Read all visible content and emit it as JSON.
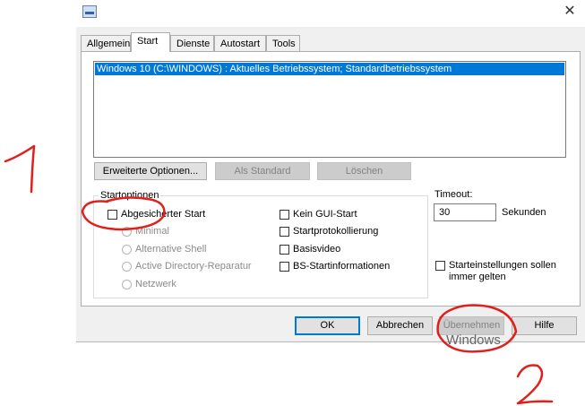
{
  "window": {
    "close_glyph": "✕"
  },
  "tabs": [
    {
      "label": "Allgemein",
      "active": false
    },
    {
      "label": "Start",
      "active": true
    },
    {
      "label": "Dienste",
      "active": false
    },
    {
      "label": "Autostart",
      "active": false
    },
    {
      "label": "Tools",
      "active": false
    }
  ],
  "boot_list": {
    "entries": [
      "Windows 10 (C:\\WINDOWS) : Aktuelles Betriebssystem; Standardbetriebssystem"
    ]
  },
  "boot_buttons": {
    "advanced": "Erweiterte Optionen...",
    "set_default": "Als Standard",
    "delete": "Löschen"
  },
  "start_options": {
    "title": "Startoptionen",
    "safe_boot": "Abgesicherter Start",
    "minimal": "Minimal",
    "alternate_shell": "Alternative Shell",
    "ad_repair": "Active Directory-Reparatur",
    "network": "Netzwerk",
    "no_gui": "Kein GUI-Start",
    "boot_log": "Startprotokollierung",
    "base_video": "Basisvideo",
    "os_info": "BS-Startinformationen"
  },
  "timeout": {
    "label": "Timeout:",
    "value": "30",
    "unit": "Sekunden"
  },
  "persist": {
    "label_line1": "Starteinstellungen sollen",
    "label_line2": "immer gelten"
  },
  "footer_buttons": {
    "ok": "OK",
    "cancel": "Abbrechen",
    "apply": "Übernehmen",
    "help": "Hilfe"
  },
  "background_text": "Windows",
  "annotation_color": "#e0201c"
}
